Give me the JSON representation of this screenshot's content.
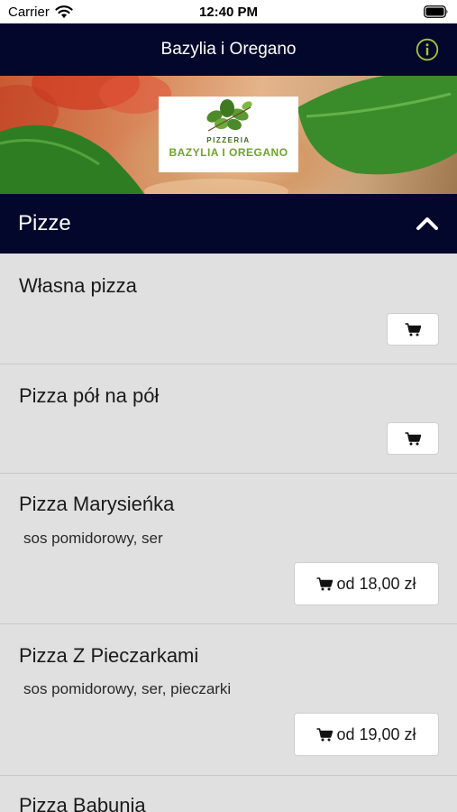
{
  "status": {
    "carrier": "Carrier",
    "time": "12:40 PM"
  },
  "nav": {
    "title": "Bazylia i Oregano",
    "info_icon": "info-icon"
  },
  "banner": {
    "logo_small": "PIZZERIA",
    "logo_name": "BAZYLIA I OREGANO"
  },
  "section": {
    "title": "Pizze",
    "state_icon": "chevron-up-icon"
  },
  "items": [
    {
      "name": "Własna pizza",
      "description": "",
      "price": ""
    },
    {
      "name": "Pizza pół na pół",
      "description": "",
      "price": ""
    },
    {
      "name": "Pizza Marysieńka",
      "description": "sos pomidorowy, ser",
      "price": "od 18,00 zł"
    },
    {
      "name": "Pizza Z Pieczarkami",
      "description": "sos pomidorowy, ser, pieczarki",
      "price": "od 19,00 zł"
    },
    {
      "name": "Pizza Babunia",
      "description": "",
      "price": ""
    }
  ],
  "colors": {
    "navy": "#03072c",
    "accent_green": "#a4c639",
    "list_bg": "#e0e0e0"
  }
}
